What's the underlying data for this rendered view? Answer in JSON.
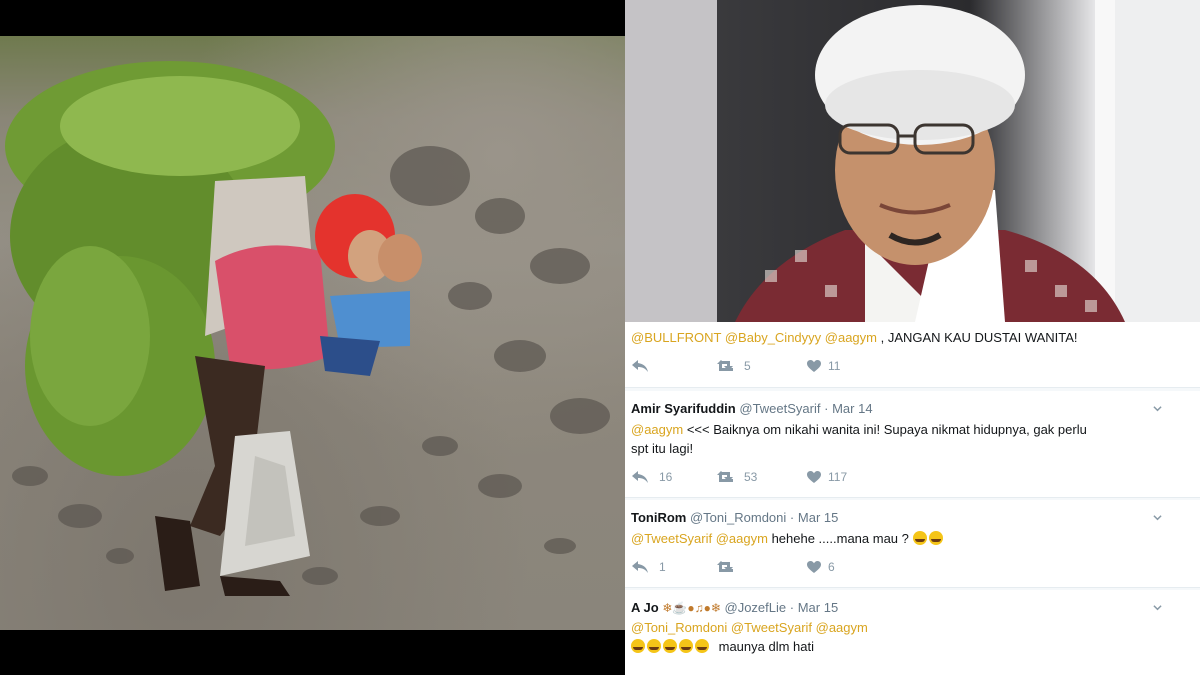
{
  "tweets": [
    {
      "name": "",
      "handle": "",
      "date": "",
      "text_parts": [
        {
          "t": "mention",
          "v": "@BULLFRONT @Baby_Cindyyy @aagym"
        },
        {
          "t": "text",
          "v": " , JANGAN KAU DUSTAI WANITA!"
        }
      ],
      "actions": {
        "reply": "",
        "retweet": "5",
        "like": "11"
      }
    },
    {
      "name": "Amir Syarifuddin",
      "handle": "@TweetSyarif",
      "date": "Mar 14",
      "line1": [
        {
          "t": "mention",
          "v": "@aagym"
        },
        {
          "t": "text",
          "v": " <<< Baiknya om nikahi wanita ini! Supaya nikmat hidupnya, gak perlu"
        }
      ],
      "line2": "spt itu lagi!",
      "actions": {
        "reply": "16",
        "retweet": "53",
        "like": "117"
      }
    },
    {
      "name": "ToniRom",
      "handle": "@Toni_Romdoni",
      "date": "Mar 15",
      "line1": [
        {
          "t": "mention",
          "v": "@TweetSyarif @aagym"
        },
        {
          "t": "text",
          "v": " hehehe .....mana mau ?"
        }
      ],
      "actions": {
        "reply": "1",
        "retweet": "",
        "like": "6"
      }
    },
    {
      "name": "A Jo",
      "handle": "@JozefLie",
      "date": "Mar 15",
      "line1_mention": "@Toni_Romdoni @TweetSyarif @aagym",
      "line2": "maunya dlm hati"
    }
  ],
  "icons": [
    "reply-icon",
    "retweet-icon",
    "heart-icon",
    "chevron-down-icon"
  ],
  "colors": {
    "mention": "#d9a520",
    "name": "#14171a",
    "meta": "#657786",
    "action": "#8899a6",
    "background": "#f5f8fa"
  }
}
